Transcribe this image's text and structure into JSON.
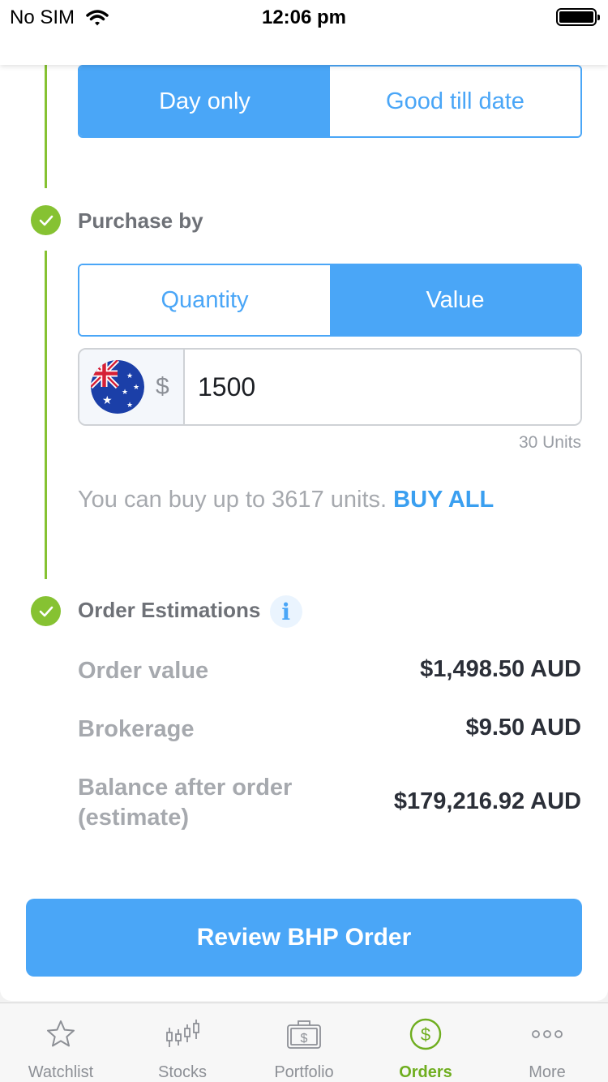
{
  "status_bar": {
    "carrier": "No SIM",
    "time": "12:06 pm"
  },
  "duration": {
    "options": [
      "Day only",
      "Good till date"
    ],
    "selected": "Day only"
  },
  "purchase_by": {
    "title": "Purchase by",
    "options": [
      "Quantity",
      "Value"
    ],
    "selected": "Value",
    "currency_symbol": "$",
    "amount": "1500",
    "units_hint": "30 Units",
    "buy_limit_text": "You can buy up to 3617 units.",
    "buy_all_label": "BUY ALL"
  },
  "order_estimations": {
    "title": "Order Estimations",
    "info_symbol": "i",
    "rows": [
      {
        "label": "Order value",
        "value": "$1,498.50 AUD"
      },
      {
        "label": "Brokerage",
        "value": "$9.50 AUD"
      },
      {
        "label_line1": "Balance after order",
        "label_line2": "(estimate)",
        "value": "$179,216.92 AUD"
      }
    ]
  },
  "review_button": "Review BHP Order",
  "tabbar": {
    "active": "Orders",
    "tabs": [
      {
        "label": "Watchlist",
        "icon": "star-icon"
      },
      {
        "label": "Stocks",
        "icon": "candlestick-icon"
      },
      {
        "label": "Portfolio",
        "icon": "briefcase-icon"
      },
      {
        "label": "Orders",
        "icon": "dollar-circle-icon"
      },
      {
        "label": "More",
        "icon": "more-dots-icon"
      }
    ]
  },
  "colors": {
    "accent": "#4aa6f7",
    "success": "#86c232",
    "active_tab": "#6fae1f"
  }
}
